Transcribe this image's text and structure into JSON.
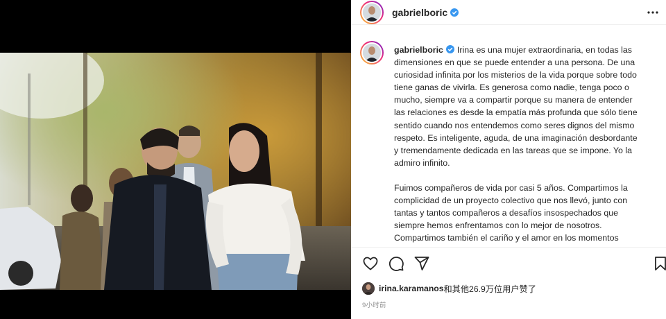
{
  "post": {
    "username": "gabrielboric",
    "caption_paragraphs": [
      "Irina es una mujer extraordinaria, en todas las dimensiones en que se puede entender a una persona. De una curiosidad infinita por los misterios de la vida porque sobre todo tiene ganas de vivirla. Es generosa como nadie, tenga poco o mucho, siempre va a compartir porque su manera de entender las relaciones es desde la empatía más profunda que sólo tiene sentido cuando nos entendemos como seres dignos del mismo respeto. Es inteligente, aguda, de una imaginación desbordante y tremendamente dedicada en las tareas que se impone. Yo la admiro infinito.",
      "Fuimos compañeros de vida por casi 5 años. Compartimos la complicidad de un proyecto colectivo que nos llevó, junto con tantas y tantos compañeros a desafíos insospechados que siempre hemos enfrentamos con lo mejor de nosotros. Compartimos también el cariño y el amor en los momentos"
    ],
    "liked_by_user": "irina.karamanos",
    "likes_suffix": "和其他26.9万位用户赞了",
    "time_ago": "9小时前"
  },
  "icons": {
    "verified": "verified-badge-icon",
    "more": "more-options-icon",
    "like": "heart-icon",
    "comment": "comment-icon",
    "share": "paper-plane-icon",
    "save": "bookmark-icon"
  },
  "colors": {
    "verified": "#3897f0",
    "text": "#262626",
    "muted": "#8e8e8e",
    "divider": "#efefef"
  }
}
